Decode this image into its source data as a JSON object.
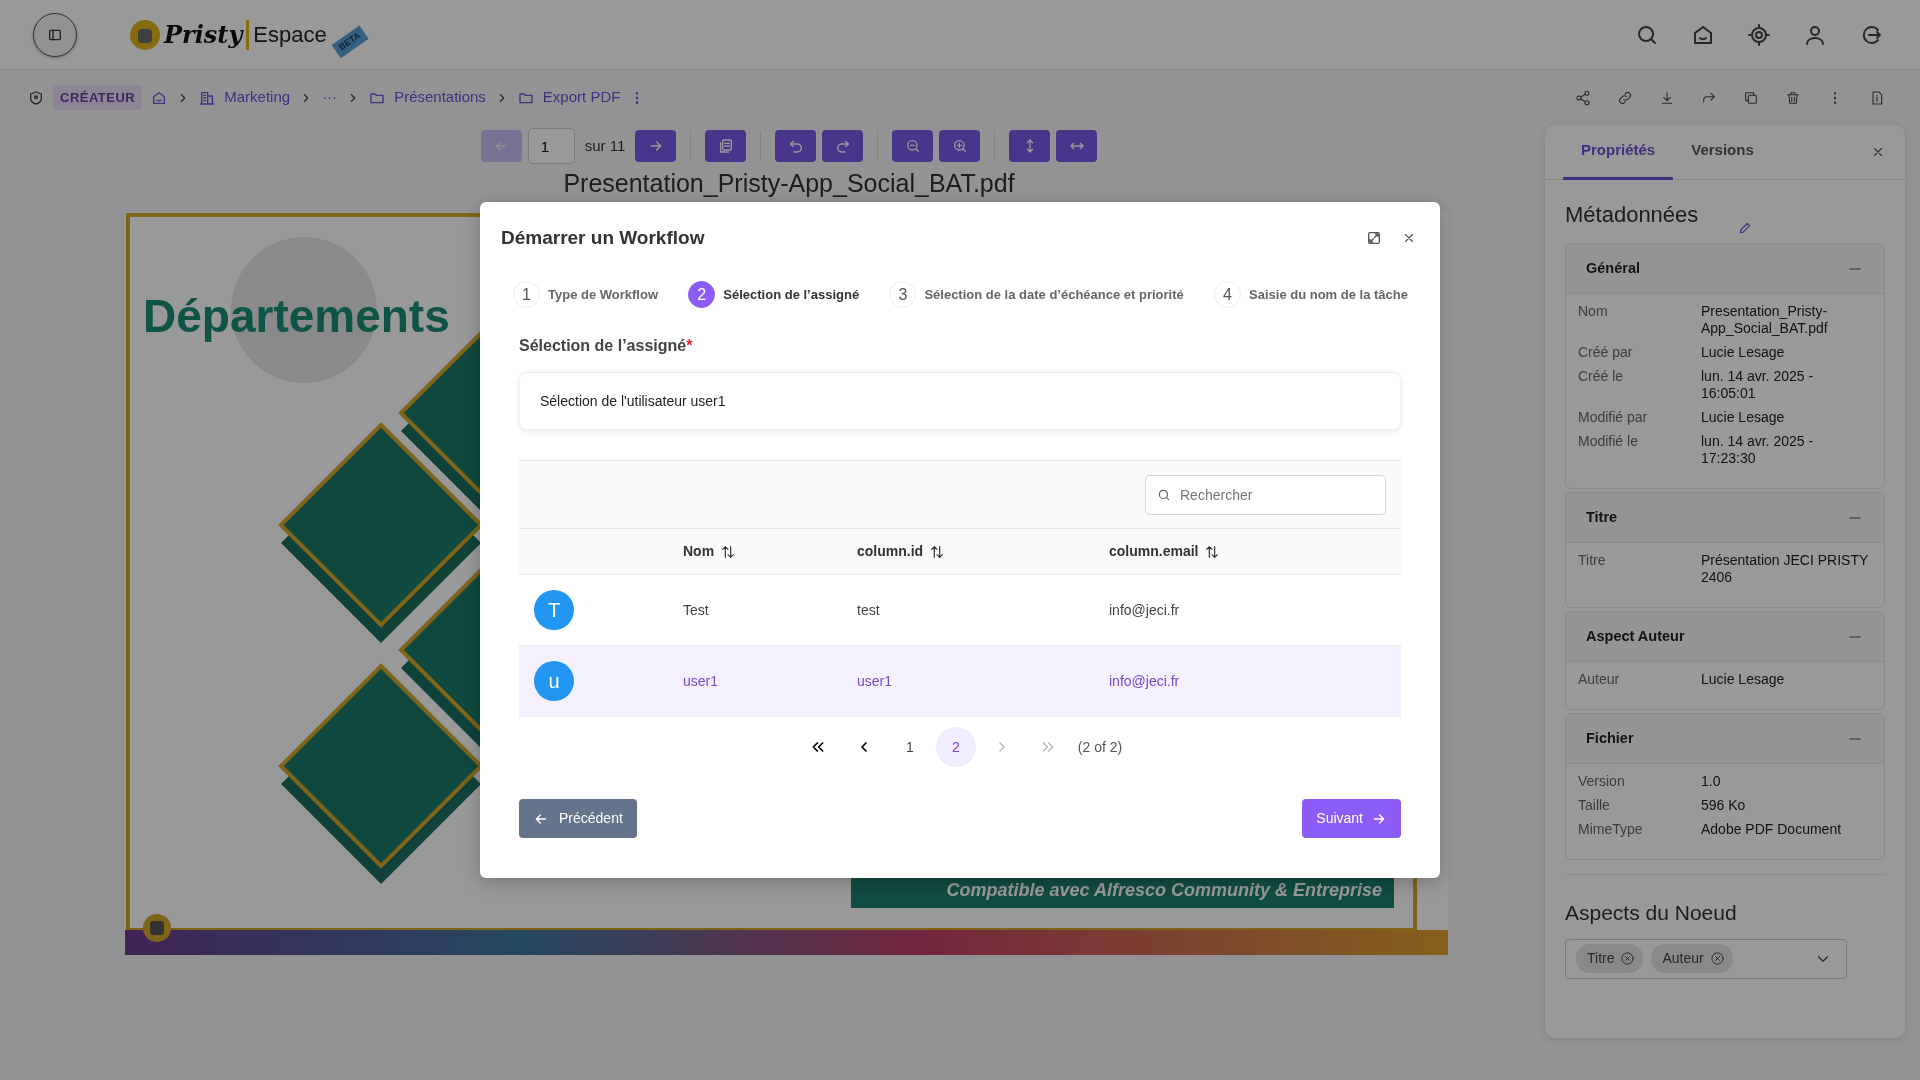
{
  "header": {
    "logo_main": "Pristy",
    "logo_sub": "Espace",
    "logo_badge": "BETA"
  },
  "breadcrumb": {
    "role": "CRÉATEUR",
    "items": [
      {
        "kind": "home"
      },
      {
        "kind": "site",
        "label": "Marketing"
      },
      {
        "kind": "more",
        "label": "···"
      },
      {
        "kind": "folder",
        "label": "Présentations"
      },
      {
        "kind": "folder",
        "label": "Export PDF"
      }
    ]
  },
  "viewer": {
    "page": "1",
    "total": "sur 11",
    "prev_disabled": true,
    "next_disabled": false,
    "file_name": "Presentation_Pristy-App_Social_BAT.pdf",
    "slide": {
      "heading": "Départements",
      "banner": "Compatible avec Alfresco Community & Entreprise"
    }
  },
  "side_panel": {
    "tabs": [
      {
        "label": "Propriétés",
        "selected": true
      },
      {
        "label": "Versions",
        "selected": false
      }
    ],
    "title": "Métadonnées",
    "groups": [
      {
        "title": "Général",
        "rows": [
          {
            "label": "Nom",
            "value": "Presentation_Pristy-App_Social_BAT.pdf"
          },
          {
            "label": "Créé par",
            "value": "Lucie Lesage"
          },
          {
            "label": "Créé le",
            "value": "lun. 14 avr. 2025 - 16:05:01"
          },
          {
            "label": "Modifié par",
            "value": "Lucie Lesage"
          },
          {
            "label": "Modifié le",
            "value": "lun. 14 avr. 2025 - 17:23:30"
          }
        ]
      },
      {
        "title": "Titre",
        "rows": [
          {
            "label": "Titre",
            "value": "Présentation JECI PRISTY 2406"
          }
        ]
      },
      {
        "title": "Aspect Auteur",
        "rows": [
          {
            "label": "Auteur",
            "value": "Lucie Lesage"
          }
        ]
      },
      {
        "title": "Fichier",
        "rows": [
          {
            "label": "Version",
            "value": "1.0"
          },
          {
            "label": "Taille",
            "value": "596 Ko"
          },
          {
            "label": "MimeType",
            "value": "Adobe PDF Document"
          }
        ]
      }
    ],
    "aspects_title": "Aspects du Noeud",
    "aspects": [
      {
        "label": "Titre"
      },
      {
        "label": "Auteur"
      }
    ]
  },
  "modal": {
    "title": "Démarrer un Workflow",
    "steps": [
      {
        "number": "1",
        "label": "Type de Workflow",
        "selected": false
      },
      {
        "number": "2",
        "label": "Sélection de l’assigné",
        "selected": true
      },
      {
        "number": "3",
        "label": "Sélection de la date d’échéance et priorité",
        "selected": false
      },
      {
        "number": "4",
        "label": "Saisie du nom de la tâche",
        "selected": false
      }
    ],
    "field_label": "Sélection de l’assigné",
    "required_mark": "*",
    "field_value": "Sélection de l'utilisateur user1",
    "search_placeholder": "Rechercher",
    "columns": [
      "Nom",
      "column.id",
      "column.email"
    ],
    "rows": [
      {
        "avatar": "T",
        "name": "Test",
        "id": "test",
        "email": "info@jeci.fr",
        "selected": false
      },
      {
        "avatar": "u",
        "name": "user1",
        "id": "user1",
        "email": "info@jeci.fr",
        "selected": true
      }
    ],
    "pagination": {
      "nav": [
        {
          "kind": "first",
          "disabled": false
        },
        {
          "kind": "prev",
          "disabled": false
        },
        {
          "kind": "next",
          "disabled": true
        },
        {
          "kind": "last",
          "disabled": true
        }
      ],
      "pages": [
        {
          "label": "1",
          "selected": false
        },
        {
          "label": "2",
          "selected": true
        }
      ],
      "summary": "(2 of 2)"
    },
    "back_button": "Précédent",
    "next_button": "Suivant"
  }
}
